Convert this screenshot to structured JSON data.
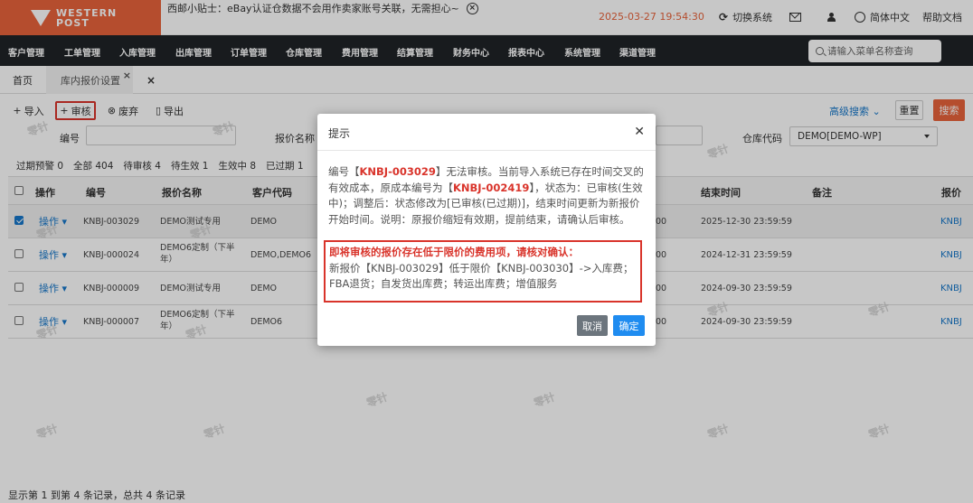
{
  "header": {
    "logo_line1": "WESTERN",
    "logo_line2": "POST",
    "tip": "西邮小贴士：eBay认证仓数据不会用作卖家账号关联，无需担心~",
    "datetime": "2025-03-27 19:54:30",
    "switch_system": "切换系统",
    "language": "简体中文",
    "help": "帮助文档"
  },
  "nav": {
    "items": [
      "客户管理",
      "工单管理",
      "入库管理",
      "出库管理",
      "订单管理",
      "仓库管理",
      "费用管理",
      "结算管理",
      "财务中心",
      "报表中心",
      "系统管理",
      "渠道管理"
    ],
    "search_placeholder": "请输入菜单名称查询"
  },
  "tabs": {
    "home": "首页",
    "active": "库内报价设置"
  },
  "toolbar": {
    "import": "导入",
    "audit": "审核",
    "discard": "废弃",
    "export": "导出",
    "advanced_search": "高级搜索",
    "reset": "重置",
    "search": "搜索"
  },
  "filters": {
    "code_label": "编号",
    "name_label": "报价名称",
    "warehouse_label": "仓库代码",
    "warehouse_value": "DEMO[DEMO-WP]"
  },
  "status_tabs": [
    "过期预警 0",
    "全部 404",
    "待审核 4",
    "待生效 1",
    "生效中 8",
    "已过期 1"
  ],
  "table": {
    "headers": {
      "action": "操作",
      "code": "编号",
      "name": "报价名称",
      "customer": "客户代码",
      "end_time": "结束时间",
      "remark": "备注",
      "tail": "报价"
    },
    "rows": [
      {
        "action": "操作",
        "code": "KNBJ-003029",
        "name": "DEMO测试专用",
        "customer": "DEMO",
        "end_time": "2025-12-30 23:59:59",
        "start_frag": "00",
        "link": "KNBJ",
        "checked": true
      },
      {
        "action": "操作",
        "code": "KNBJ-000024",
        "name": "DEMO6定制（下半年）",
        "customer": "DEMO,DEMO6",
        "end_time": "2024-12-31 23:59:59",
        "start_frag": "00",
        "link": "KNBJ",
        "checked": false
      },
      {
        "action": "操作",
        "code": "KNBJ-000009",
        "name": "DEMO测试专用",
        "customer": "DEMO",
        "end_time": "2024-09-30 23:59:59",
        "start_frag": "00",
        "link": "KNBJ",
        "checked": false
      },
      {
        "action": "操作",
        "code": "KNBJ-000007",
        "name": "DEMO6定制（下半年）",
        "customer": "DEMO6",
        "end_time": "2024-09-30 23:59:59",
        "start_frag": "00",
        "link": "KNBJ",
        "checked": false
      }
    ]
  },
  "footer": "显示第 1 到第 4 条记录，总共 4 条记录",
  "watermark": "零针",
  "modal": {
    "title": "提示",
    "p1": "编号【",
    "code1": "KNBJ-003029",
    "p2": "】无法审核。当前导入系统已存在时间交叉的有效成本，原成本编号为【",
    "code2": "KNBJ-002419",
    "p3": "】，状态为：已审核(生效中)；调整后：状态修改为[已审核(已过期)]，结束时间更新为新报价开始时间。说明：原报价缩短有效期，提前结束，请确认后审核。",
    "warn_title": "即将审核的报价存在低于限价的费用项，请核对确认：",
    "warn_text": "新报价【KNBJ-003029】低于限价【KNBJ-003030】->入库费；FBA退货；自发货出库费；转运出库费；增值服务",
    "cancel": "取消",
    "ok": "确定"
  }
}
